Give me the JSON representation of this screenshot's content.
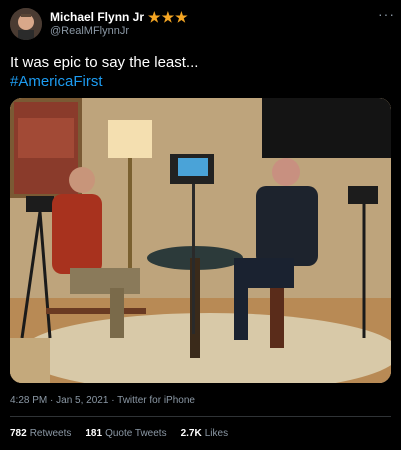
{
  "author": {
    "display_name": "Michael Flynn Jr",
    "handle": "@RealMFlynnJr",
    "badges": [
      "star-icon",
      "star-icon",
      "star-icon"
    ],
    "badge_color": "#f5a623"
  },
  "more_icon": "more-horizontal-icon",
  "tweet": {
    "text": "It was epic to say the least...",
    "hashtag": "#AmericaFirst",
    "link_color": "#1d9bf0"
  },
  "meta": {
    "time": "4:28 PM",
    "date": "Jan 5, 2021",
    "separator": "·",
    "source": "Twitter for iPhone"
  },
  "stats": {
    "retweets_count": "782",
    "retweets_label": "Retweets",
    "quotes_count": "181",
    "quotes_label": "Quote Tweets",
    "likes_count": "2.7K",
    "likes_label": "Likes"
  }
}
